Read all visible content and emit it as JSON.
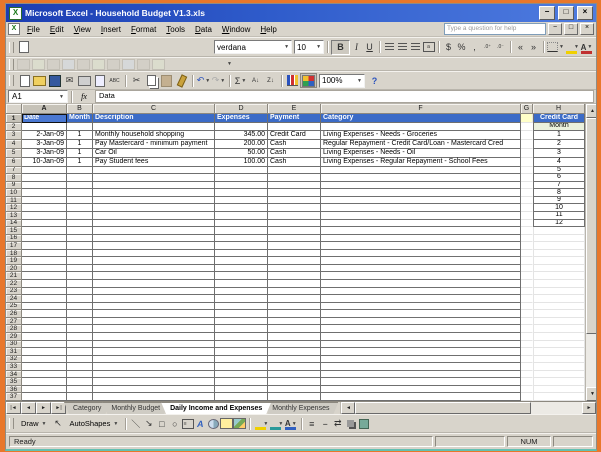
{
  "window": {
    "title": "Microsoft Excel - Household Budget V1.3.xls"
  },
  "menu": {
    "items": [
      "File",
      "Edit",
      "View",
      "Insert",
      "Format",
      "Tools",
      "Data",
      "Window",
      "Help"
    ],
    "help_box": "Type a question for help"
  },
  "toolbars": {
    "formatting": {
      "font": "verdana",
      "size": "10",
      "bold": "B",
      "italic": "I",
      "underline": "U",
      "currency": "$",
      "percent": "%",
      "comma": ",",
      "font_color_letter": "A"
    },
    "standard": {
      "zoom": "100%",
      "spell": "ABC",
      "sort_az": "A↓",
      "sort_za": "Z↓",
      "help": "?"
    }
  },
  "formula_bar": {
    "name_box": "A1",
    "fx": "fx",
    "value": "Data"
  },
  "grid": {
    "column_letters": [
      "A",
      "B",
      "C",
      "D",
      "E",
      "F",
      "G",
      "H"
    ],
    "num_rows": 37,
    "cells": {
      "1": {
        "A": "Date",
        "B": "Month",
        "C": "Description",
        "D": "Expenses",
        "E": "Payment",
        "F": "Category",
        "H": "Credit Card"
      },
      "2": {
        "H": "Month"
      },
      "3": {
        "A": "2-Jan-09",
        "B": "1",
        "C": "Monthly household shopping",
        "D": "345.00",
        "E": "Credit Card",
        "F": "Living Expenses - Needs - Groceries",
        "H": "1"
      },
      "4": {
        "A": "3-Jan-09",
        "B": "1",
        "C": "Pay Mastercard - minimum payment",
        "D": "200.00",
        "E": "Cash",
        "F": "Regular Repayment - Credit Card/Loan - Mastercard Cred",
        "H": "2"
      },
      "5": {
        "A": "3-Jan-09",
        "B": "1",
        "C": "Car Oil",
        "D": "50.00",
        "E": "Cash",
        "F": "Living Expenses - Needs - Oil",
        "H": "3"
      },
      "6": {
        "A": "10-Jan-09",
        "B": "1",
        "C": "Pay Student fees",
        "D": "100.00",
        "E": "Cash",
        "F": "Living Expenses - Regular Repayment - School Fees",
        "H": "4"
      },
      "7": {
        "H": "5"
      },
      "8": {
        "H": "6"
      },
      "9": {
        "H": "7"
      },
      "10": {
        "H": "8"
      },
      "11": {
        "H": "9"
      },
      "12": {
        "H": "10"
      },
      "13": {
        "H": "11"
      },
      "14": {
        "H": "12"
      }
    }
  },
  "tabs": {
    "nav": [
      "|◄",
      "◄",
      "►",
      "►|"
    ],
    "items": [
      {
        "label": "Category",
        "active": false
      },
      {
        "label": "Monthly Budget",
        "active": false
      },
      {
        "label": "Daily Income and Expenses",
        "active": true
      },
      {
        "label": "Monthly Expenses",
        "active": false
      }
    ]
  },
  "drawing": {
    "draw": "Draw",
    "autoshapes": "AutoShapes",
    "wordart_letter": "A",
    "font_color_letter": "A"
  },
  "status": {
    "left": "Ready",
    "num": "NUM"
  },
  "colors": {
    "frame": "#e8772b",
    "titlebar_left": "#1c3db2",
    "titlebar_right": "#4f7ce0",
    "header_fill": "#3b6bc7",
    "header_text": "#ffffff",
    "month_cell": "#ebf1dd",
    "g1_cell": "#ffffc8",
    "chrome": "#d8d4cb"
  }
}
